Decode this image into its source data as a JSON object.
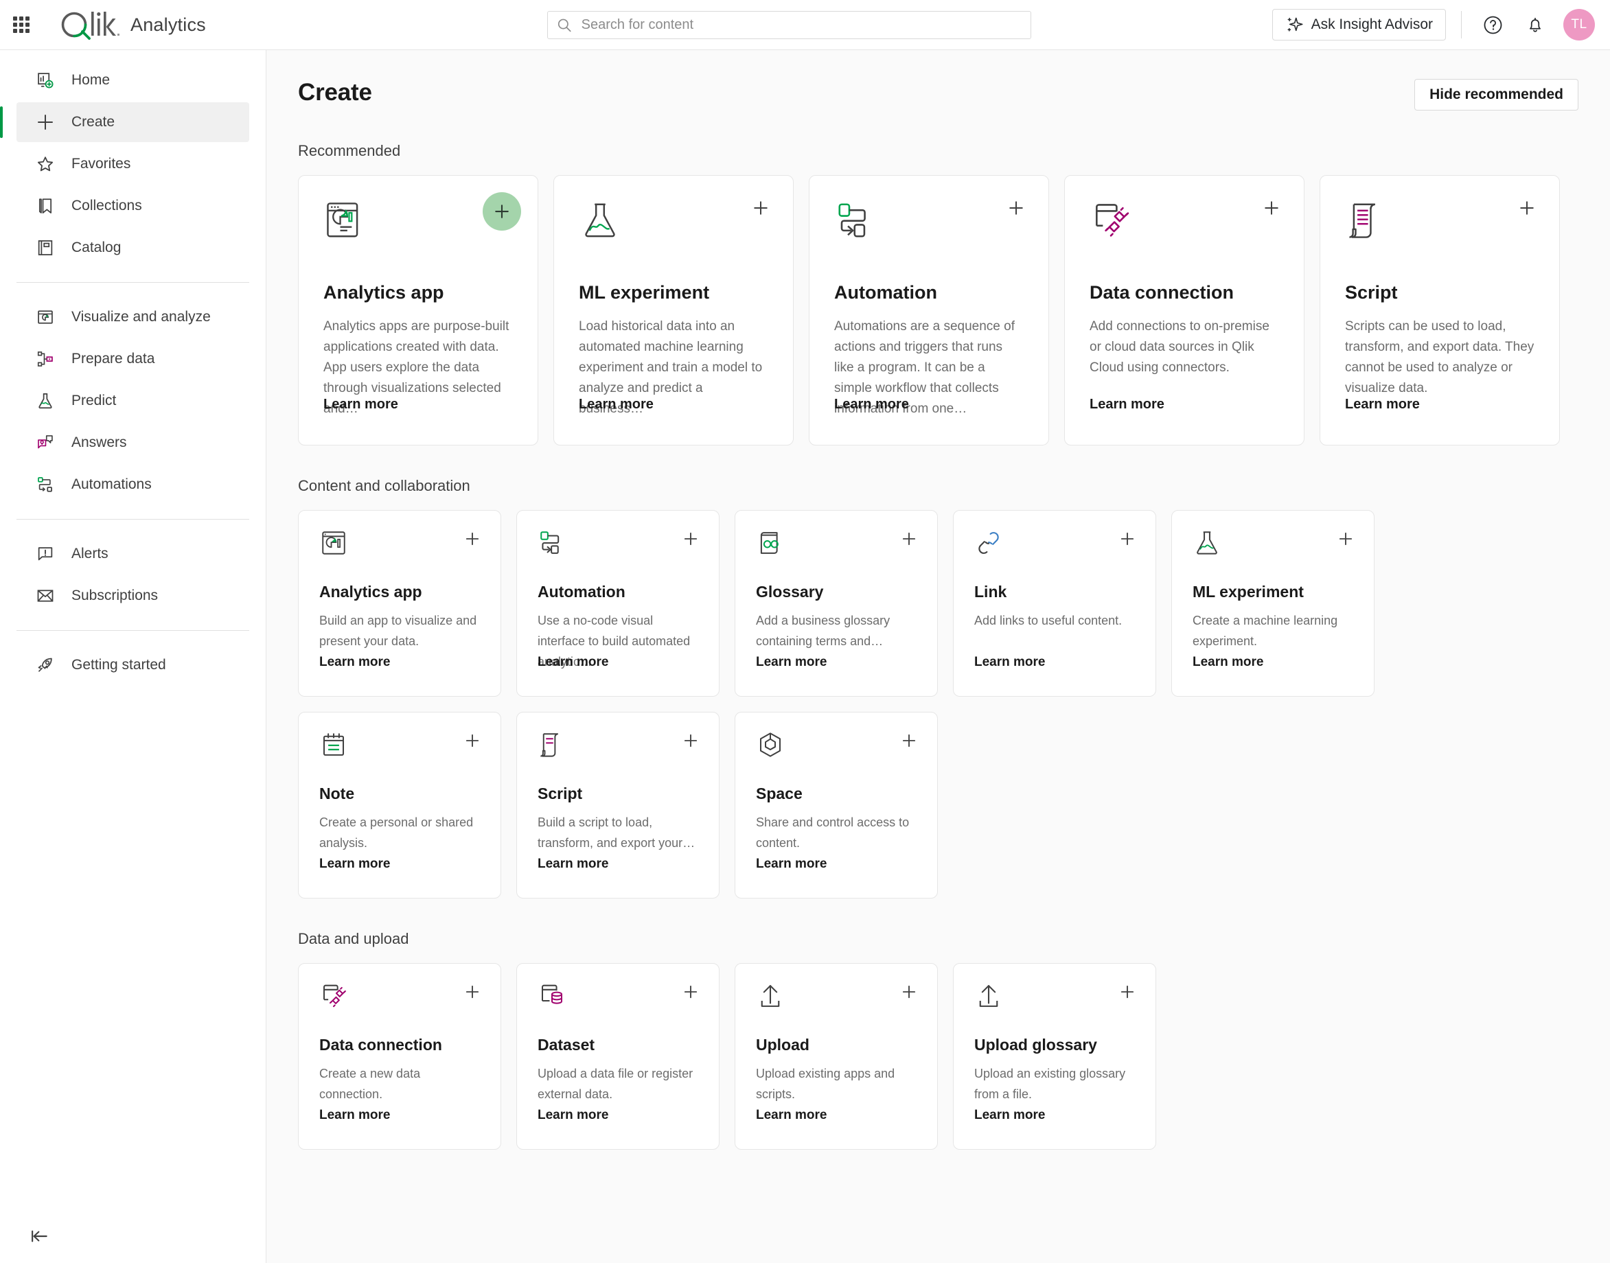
{
  "header": {
    "brand": "Analytics",
    "logo_alt": "Qlik",
    "search": {
      "placeholder": "Search for content",
      "value": ""
    },
    "insight_advisor_label": "Ask Insight Advisor",
    "avatar_initials": "TL"
  },
  "sidebar": {
    "groups": [
      {
        "items": [
          {
            "label": "Home",
            "icon": "home-dashboard-icon",
            "active": false
          },
          {
            "label": "Create",
            "icon": "plus-icon",
            "active": true
          },
          {
            "label": "Favorites",
            "icon": "star-icon",
            "active": false
          },
          {
            "label": "Collections",
            "icon": "bookmark-icon",
            "active": false
          },
          {
            "label": "Catalog",
            "icon": "book-icon",
            "active": false
          }
        ]
      },
      {
        "items": [
          {
            "label": "Visualize and analyze",
            "icon": "chart-window-icon",
            "active": false
          },
          {
            "label": "Prepare data",
            "icon": "data-nodes-icon",
            "active": false
          },
          {
            "label": "Predict",
            "icon": "flask-icon",
            "active": false
          },
          {
            "label": "Answers",
            "icon": "chat-bubbles-icon",
            "active": false
          },
          {
            "label": "Automations",
            "icon": "automation-flow-icon",
            "active": false
          }
        ]
      },
      {
        "items": [
          {
            "label": "Alerts",
            "icon": "alert-bubble-icon",
            "active": false
          },
          {
            "label": "Subscriptions",
            "icon": "envelope-icon",
            "active": false
          }
        ]
      },
      {
        "items": [
          {
            "label": "Getting started",
            "icon": "rocket-icon",
            "active": false
          }
        ]
      }
    ],
    "collapse_label": "Collapse sidebar"
  },
  "main": {
    "page_title": "Create",
    "hide_recommended_label": "Hide recommended",
    "learn_more_label": "Learn more",
    "sections": [
      {
        "id": "recommended",
        "title": "Recommended",
        "cards": [
          {
            "title": "Analytics app",
            "desc": "Analytics apps are purpose-built applications created with data. App users explore the data through visualizations selected and…",
            "icon": "analytics-app-icon",
            "highlighted": true
          },
          {
            "title": "ML experiment",
            "desc": "Load historical data into an automated machine learning experiment and train a model to analyze and predict a business…",
            "icon": "flask-icon",
            "highlighted": false
          },
          {
            "title": "Automation",
            "desc": "Automations are a sequence of actions and triggers that runs like a program. It can be a simple workflow that collects information from one…",
            "icon": "automation-flow-icon",
            "highlighted": false
          },
          {
            "title": "Data connection",
            "desc": "Add connections to on-premise or cloud data sources in Qlik Cloud using connectors.",
            "icon": "data-connection-icon",
            "highlighted": false
          },
          {
            "title": "Script",
            "desc": "Scripts can be used to load, transform, and export data. They cannot be used to analyze or visualize data.",
            "icon": "script-scroll-icon",
            "highlighted": false
          }
        ]
      },
      {
        "id": "content-and-collaboration",
        "title": "Content and collaboration",
        "cards": [
          {
            "title": "Analytics app",
            "desc": "Build an app to visualize and present your data.",
            "icon": "analytics-app-small-icon"
          },
          {
            "title": "Automation",
            "desc": "Use a no-code visual interface to build automated analytic…",
            "icon": "automation-flow-icon"
          },
          {
            "title": "Glossary",
            "desc": "Add a business glossary containing terms and…",
            "icon": "glossary-book-icon"
          },
          {
            "title": "Link",
            "desc": "Add links to useful content.",
            "icon": "link-icon"
          },
          {
            "title": "ML experiment",
            "desc": "Create a machine learning experiment.",
            "icon": "flask-icon"
          },
          {
            "title": "Note",
            "desc": "Create a personal or shared analysis.",
            "icon": "note-icon"
          },
          {
            "title": "Script",
            "desc": "Build a script to load, transform, and export your…",
            "icon": "script-scroll-icon"
          },
          {
            "title": "Space",
            "desc": "Share and control access to content.",
            "icon": "space-cube-icon"
          }
        ]
      },
      {
        "id": "data-and-upload",
        "title": "Data and upload",
        "cards": [
          {
            "title": "Data connection",
            "desc": "Create a new data connection.",
            "icon": "data-connection-icon"
          },
          {
            "title": "Dataset",
            "desc": "Upload a data file or register external data.",
            "icon": "dataset-icon"
          },
          {
            "title": "Upload",
            "desc": "Upload existing apps and scripts.",
            "icon": "upload-icon"
          },
          {
            "title": "Upload glossary",
            "desc": "Upload an existing glossary from a file.",
            "icon": "upload-icon"
          }
        ]
      }
    ]
  },
  "colors": {
    "accent_green": "#009845",
    "icon_green": "#00A54F",
    "icon_purple": "#A0006E",
    "icon_blue": "#3B7FC4",
    "avatar_pink": "#EE99C3",
    "highlight_pill": "#A4D4AB",
    "text_primary": "#1A1A1A",
    "text_secondary": "#6C6C6C",
    "page_bg": "#FAFAFA",
    "card_border": "#E6E6E6"
  }
}
